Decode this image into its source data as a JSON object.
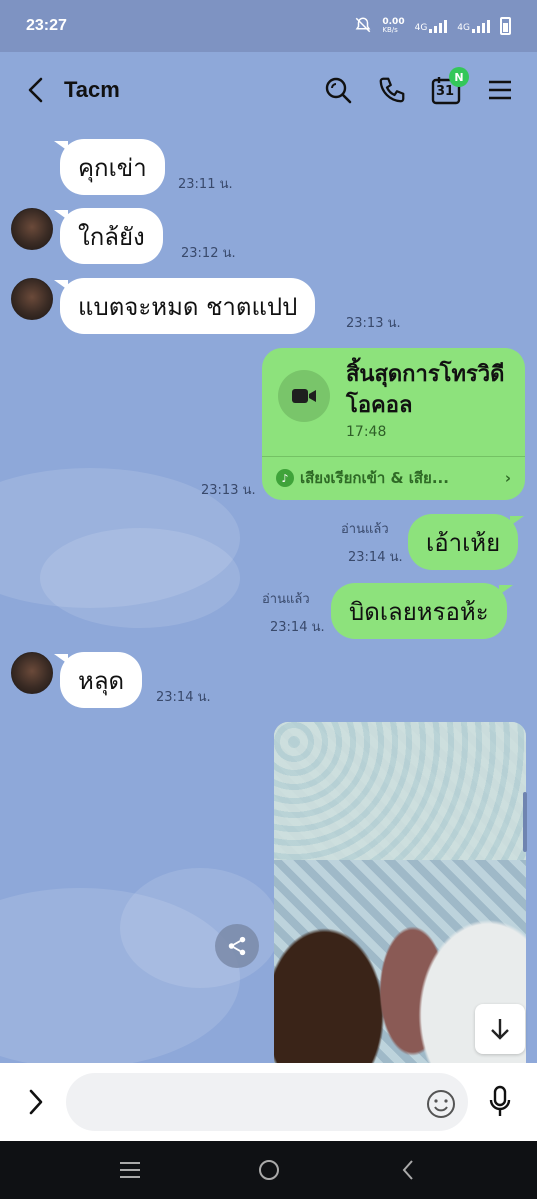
{
  "status_bar": {
    "time": "23:27",
    "net_speed": "0.00",
    "net_unit": "KB/s",
    "net_type_1": "4G",
    "net_type_2": "4G"
  },
  "header": {
    "contact_name": "Tacm",
    "calendar_day": "31",
    "calendar_badge": "N"
  },
  "messages": [
    {
      "side": "in",
      "text": "คุกเข่า",
      "time": "23:11 น."
    },
    {
      "side": "in",
      "text": "ใกล้ยัง",
      "time": "23:12 น."
    },
    {
      "side": "in",
      "text": "แบตจะหมด ชาตแปป",
      "time": "23:13 น."
    },
    {
      "side": "out",
      "type": "call",
      "title": "สิ้นสุดการโทรวิดีโอคอล",
      "duration": "17:48",
      "footer": "เสียงเรียกเข้า & เสีย...",
      "time": "23:13 น."
    },
    {
      "side": "out",
      "text": "เอ้าเห้ย",
      "read": "อ่านแล้ว",
      "time": "23:14 น."
    },
    {
      "side": "out",
      "text": "บิดเลยหรอห้ะ",
      "read": "อ่านแล้ว",
      "time": "23:14 น."
    },
    {
      "side": "in",
      "text": "หลุด",
      "time": "23:14 น."
    },
    {
      "side": "out",
      "type": "image"
    }
  ],
  "composer": {
    "placeholder": ""
  },
  "colors": {
    "chat_background": "#8ea8d9",
    "outgoing_bubble": "#8de27c",
    "incoming_bubble": "#ffffff",
    "badge_green": "#34c759"
  }
}
